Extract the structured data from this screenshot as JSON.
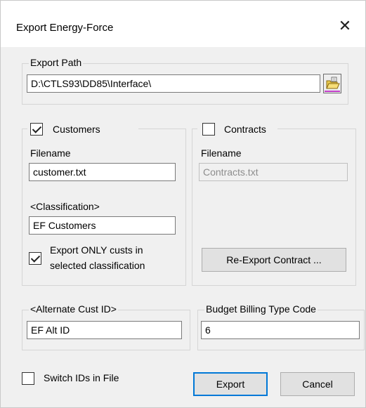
{
  "window": {
    "title": "Export Energy-Force",
    "close_glyph": "✕"
  },
  "export_path": {
    "label": "Export Path",
    "value": "D:\\CTLS93\\DD85\\Interface\\",
    "browse_icon": "folder-open-icon"
  },
  "customers": {
    "label": "Customers",
    "checked": true,
    "filename_label": "Filename",
    "filename_value": "customer.txt",
    "classification_label": "<Classification>",
    "classification_value": "EF Customers",
    "export_only_label_line1": "Export ONLY custs in",
    "export_only_label_line2": "selected classification",
    "export_only_checked": true
  },
  "contracts": {
    "label": "Contracts",
    "checked": false,
    "filename_label": "Filename",
    "filename_value": "Contracts.txt",
    "reexport_button": "Re-Export Contract ..."
  },
  "alternate_cust_id": {
    "label": "<Alternate Cust ID>",
    "value": "EF Alt ID"
  },
  "budget_billing": {
    "label": "Budget Billing Type Code",
    "value": "6"
  },
  "switch_ids": {
    "label": "Switch IDs in File",
    "checked": false
  },
  "buttons": {
    "export": "Export",
    "cancel": "Cancel"
  }
}
